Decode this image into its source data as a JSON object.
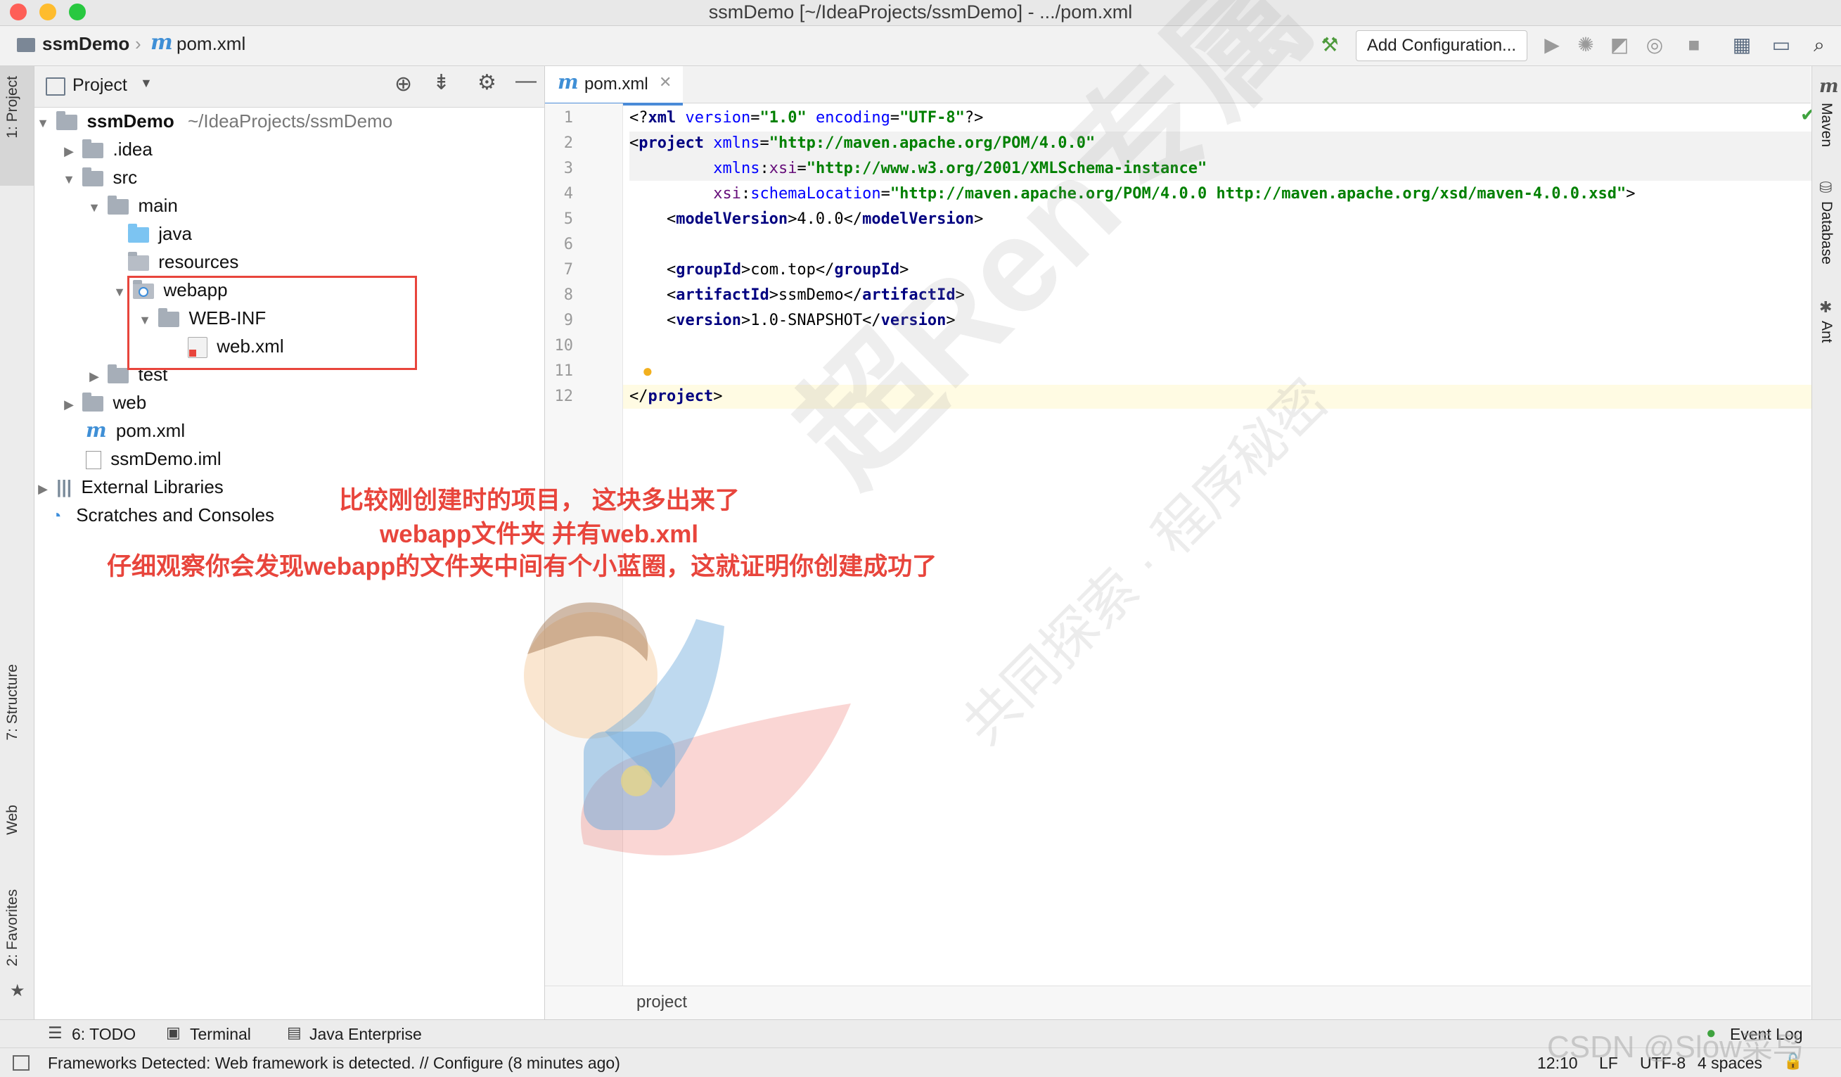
{
  "window": {
    "title": "ssmDemo [~/IdeaProjects/ssmDemo] - .../pom.xml"
  },
  "nav": {
    "project": "ssmDemo",
    "file": "pom.xml",
    "file_icon_letter": "m",
    "add_config": "Add Configuration..."
  },
  "left_stripe": {
    "project": "1: Project",
    "structure": "7: Structure",
    "web": "Web",
    "favorites": "2: Favorites"
  },
  "right_stripe": {
    "maven": "Maven",
    "database": "Database",
    "ant": "Ant"
  },
  "project_panel": {
    "header": "Project",
    "root": {
      "name": "ssmDemo",
      "path": "~/IdeaProjects/ssmDemo"
    },
    "items": {
      "idea": ".idea",
      "src": "src",
      "main": "main",
      "java": "java",
      "resources": "resources",
      "webapp": "webapp",
      "webinf": "WEB-INF",
      "webxml": "web.xml",
      "test": "test",
      "web": "web",
      "pom": "pom.xml",
      "iml": "ssmDemo.iml",
      "libs": "External Libraries",
      "scratches": "Scratches and Consoles"
    }
  },
  "editor": {
    "tab": "pom.xml",
    "line_numbers": [
      "1",
      "2",
      "3",
      "4",
      "5",
      "6",
      "7",
      "8",
      "9",
      "10",
      "11",
      "12"
    ],
    "breadcrumb": "project"
  },
  "annotations": {
    "line1": "比较刚创建时的项目， 这块多出来了",
    "line2": "webapp文件夹  并有web.xml",
    "line3": "仔细观察你会发现webapp的文件夹中间有个小蓝圈，这就证明你创建成功了"
  },
  "watermark": {
    "main": "超Ren专属",
    "sub": "共同探索 · 程序秘密",
    "csdn": "CSDN @Slow菜鸟"
  },
  "bottom_tools": {
    "todo": "6: TODO",
    "terminal": "Terminal",
    "java_enterprise": "Java Enterprise",
    "event_log": "Event Log"
  },
  "status": {
    "message": "Frameworks Detected: Web framework is detected. // Configure (8 minutes ago)",
    "position": "12:10",
    "line_sep": "LF",
    "encoding": "UTF-8",
    "indent": "4 spaces"
  },
  "colors": {
    "accent": "#4a8bd8",
    "annotation": "#e8453c",
    "string": "#008000",
    "tag": "#000080"
  }
}
